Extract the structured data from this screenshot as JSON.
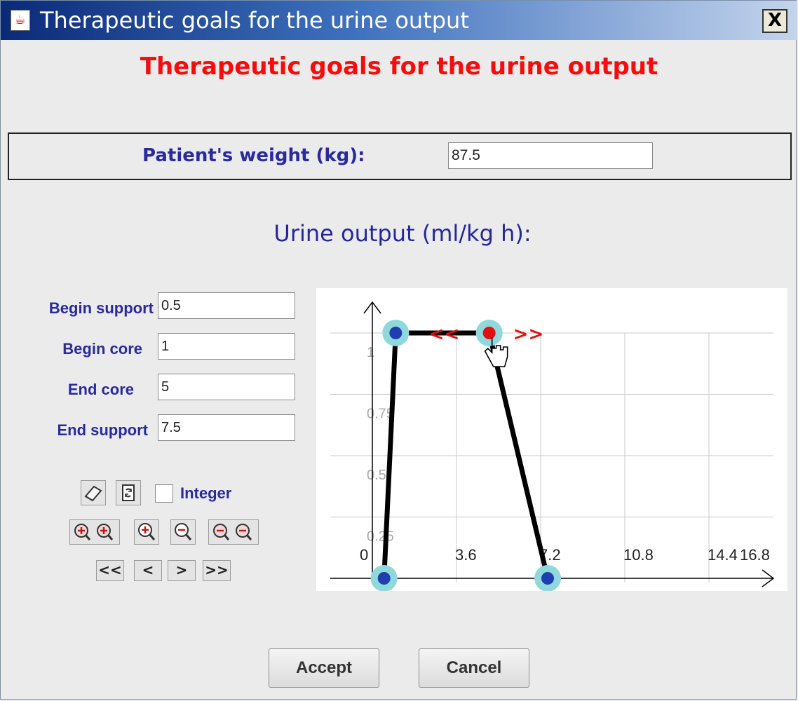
{
  "window": {
    "title": "Therapeutic goals for the urine output",
    "close_label": "X"
  },
  "heading": "Therapeutic goals for the urine output",
  "weight": {
    "label": "Patient's weight (kg):",
    "value": "87.5"
  },
  "urine_title": "Urine output (ml/kg h):",
  "fields": [
    {
      "label": "Begin support",
      "value": "0.5"
    },
    {
      "label": "Begin core",
      "value": "1"
    },
    {
      "label": "End core",
      "value": "5"
    },
    {
      "label": "End support",
      "value": "7.5"
    }
  ],
  "toolbar": {
    "integer_label": "Integer",
    "integer_checked": false
  },
  "nav": [
    "<<",
    "<",
    ">",
    ">>"
  ],
  "buttons": {
    "accept": "Accept",
    "cancel": "Cancel"
  },
  "chart_data": {
    "type": "line",
    "x_ticks": [
      "0",
      "3.6",
      "7.2",
      "10.8",
      "14.4",
      "16.8"
    ],
    "y_ticks": [
      "0.25",
      "0.5",
      "0.75",
      "1"
    ],
    "xlim": [
      0,
      16.8
    ],
    "ylim": [
      0,
      1
    ],
    "series": [
      {
        "points": [
          [
            0.5,
            0
          ],
          [
            1,
            1
          ],
          [
            5,
            1
          ],
          [
            7.5,
            0
          ]
        ]
      }
    ],
    "highlighted_point": 2,
    "drag_hint_left": "<<",
    "drag_hint_right": ">>",
    "colors": {
      "line": "#000000",
      "point": "#1d3fb0",
      "halo": "#8fd8dc",
      "selected": "#e01010",
      "arrows": "#e01010",
      "grid": "#c8c8c8",
      "tick": "#a9a9a9"
    }
  }
}
